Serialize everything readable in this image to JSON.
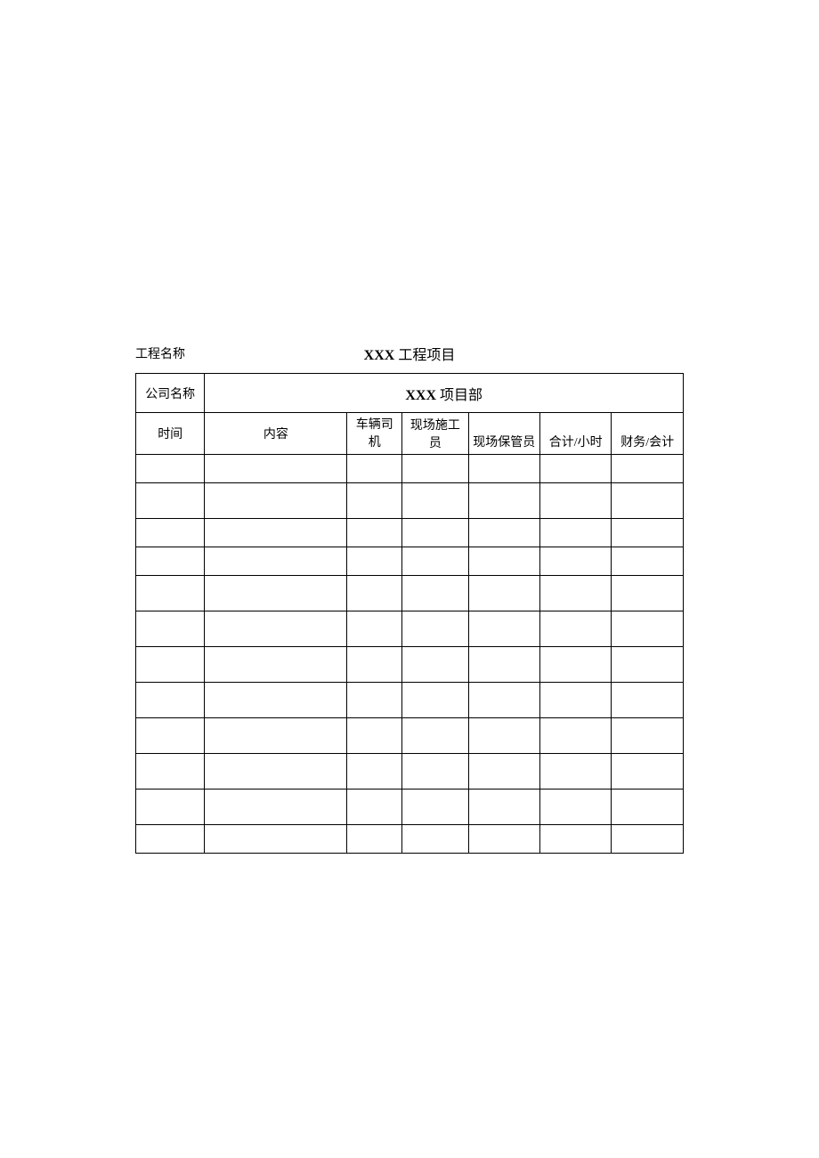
{
  "header": {
    "project_label": "工程名称",
    "project_title_bold": "XXX",
    "project_title_rest": " 工程项目"
  },
  "table": {
    "company_label": "公司名称",
    "company_title_bold": "XXX",
    "company_title_rest": " 项目部",
    "columns": {
      "time": "时间",
      "content": "内容",
      "driver": "车辆司机",
      "worker": "现场施工员",
      "keeper": "现场保管员",
      "total": "合计/小时",
      "finance": "财务/会计"
    },
    "rows": [
      {
        "time": "",
        "content": "",
        "driver": "",
        "worker": "",
        "keeper": "",
        "total": "",
        "finance": ""
      },
      {
        "time": "",
        "content": "",
        "driver": "",
        "worker": "",
        "keeper": "",
        "total": "",
        "finance": ""
      },
      {
        "time": "",
        "content": "",
        "driver": "",
        "worker": "",
        "keeper": "",
        "total": "",
        "finance": ""
      },
      {
        "time": "",
        "content": "",
        "driver": "",
        "worker": "",
        "keeper": "",
        "total": "",
        "finance": ""
      },
      {
        "time": "",
        "content": "",
        "driver": "",
        "worker": "",
        "keeper": "",
        "total": "",
        "finance": ""
      },
      {
        "time": "",
        "content": "",
        "driver": "",
        "worker": "",
        "keeper": "",
        "total": "",
        "finance": ""
      },
      {
        "time": "",
        "content": "",
        "driver": "",
        "worker": "",
        "keeper": "",
        "total": "",
        "finance": ""
      },
      {
        "time": "",
        "content": "",
        "driver": "",
        "worker": "",
        "keeper": "",
        "total": "",
        "finance": ""
      },
      {
        "time": "",
        "content": "",
        "driver": "",
        "worker": "",
        "keeper": "",
        "total": "",
        "finance": ""
      },
      {
        "time": "",
        "content": "",
        "driver": "",
        "worker": "",
        "keeper": "",
        "total": "",
        "finance": ""
      },
      {
        "time": "",
        "content": "",
        "driver": "",
        "worker": "",
        "keeper": "",
        "total": "",
        "finance": ""
      },
      {
        "time": "",
        "content": "",
        "driver": "",
        "worker": "",
        "keeper": "",
        "total": "",
        "finance": ""
      }
    ]
  }
}
